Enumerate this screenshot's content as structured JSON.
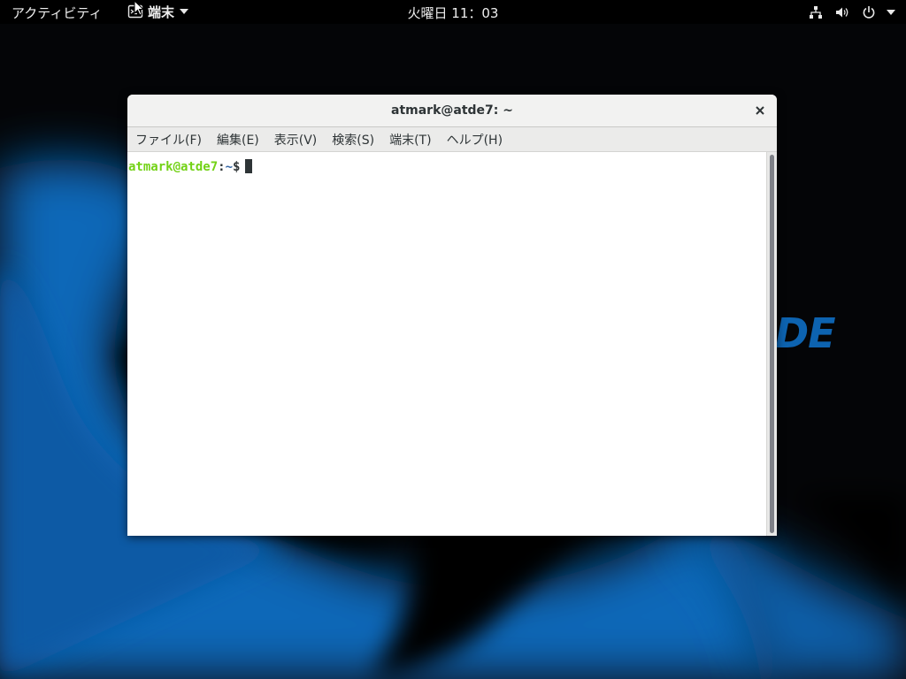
{
  "topbar": {
    "activities": "アクティビティ",
    "app_name": "端末",
    "clock": "火曜日 11：03",
    "icons": [
      "terminal-app-icon",
      "network-icon",
      "volume-icon",
      "power-icon",
      "chevron-down-icon"
    ]
  },
  "wallpaper": {
    "logo_text": "DE",
    "colors": {
      "blue": "#0d63b0",
      "dark": "#050608"
    }
  },
  "window": {
    "title": "atmark@atde7: ~",
    "menu": {
      "file": "ファイル(F)",
      "edit": "編集(E)",
      "view": "表示(V)",
      "search": "検索(S)",
      "terminal": "端末(T)",
      "help": "ヘルプ(H)"
    },
    "terminal": {
      "prompt_user": "atmark@atde7",
      "prompt_sep": ":",
      "prompt_path": "~",
      "prompt_symbol": "$",
      "colors": {
        "user": "#73d216",
        "path": "#3465a4",
        "text": "#2e3436"
      }
    }
  }
}
